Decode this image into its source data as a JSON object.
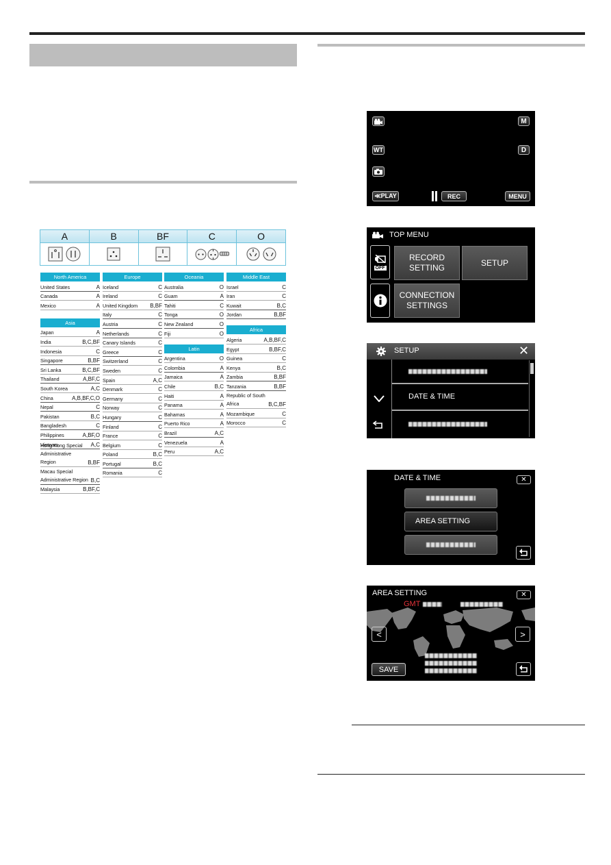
{
  "plug_types": [
    {
      "label": "A",
      "icons": [
        "plug-a-flat-ground-icon",
        "plug-a-flat-icon"
      ]
    },
    {
      "label": "B",
      "icons": [
        "plug-b-three-round-icon"
      ]
    },
    {
      "label": "BF",
      "icons": [
        "plug-bf-rectangular-icon"
      ]
    },
    {
      "label": "C",
      "icons": [
        "plug-c-two-round-icon",
        "plug-c-grounded-icon",
        "plug-c-side-icon"
      ]
    },
    {
      "label": "O",
      "icons": [
        "plug-o-three-angled-icon",
        "plug-o-two-angled-icon"
      ]
    }
  ],
  "regions": {
    "north_america": {
      "title": "North America",
      "rows": [
        {
          "country": "United States",
          "types": "A"
        },
        {
          "country": "Canada",
          "types": "A"
        },
        {
          "country": "Mexico",
          "types": "A"
        }
      ]
    },
    "asia": {
      "title": "Asia",
      "rows": [
        {
          "country": "Japan",
          "types": "A"
        },
        {
          "country": "India",
          "types": "B,C,BF"
        },
        {
          "country": "Indonesia",
          "types": "C"
        },
        {
          "country": "Singapore",
          "types": "B,BF"
        },
        {
          "country": "Sri Lanka",
          "types": "B,C,BF"
        },
        {
          "country": "Thailand",
          "types": "A,BF,C"
        },
        {
          "country": "South Korea",
          "types": "A,C"
        },
        {
          "country": "China",
          "types": "A,B,BF,C,O"
        },
        {
          "country": "Nepal",
          "types": "C"
        },
        {
          "country": "Pakistan",
          "types": "B,C"
        },
        {
          "country": "Bangladesh",
          "types": "C"
        },
        {
          "country": "Philippines",
          "types": "A,BF,O"
        },
        {
          "country": "Vietnam",
          "types": "A,C"
        },
        {
          "country": "Hong Kong Special Administrative Region",
          "line1": "Hong Kong Special",
          "line2": "Administrative Region",
          "types": "B,BF"
        },
        {
          "country": "Macau Special Administrative Region",
          "line1": "Macau Special",
          "line2": "Administrative Region",
          "types": "B,C"
        },
        {
          "country": "Malaysia",
          "types": "B,BF,C"
        }
      ]
    },
    "europe": {
      "title": "Europe",
      "rows": [
        {
          "country": "Iceland",
          "types": "C"
        },
        {
          "country": "Ireland",
          "types": "C"
        },
        {
          "country": "United Kingdom",
          "types": "B,BF"
        },
        {
          "country": "Italy",
          "types": "C"
        },
        {
          "country": "Austria",
          "types": "C"
        },
        {
          "country": "Netherlands",
          "types": "C"
        },
        {
          "country": "Canary Islands",
          "types": "C"
        },
        {
          "country": "Greece",
          "types": "C"
        },
        {
          "country": "Switzerland",
          "types": "C"
        },
        {
          "country": "Sweden",
          "types": "C"
        },
        {
          "country": "Spain",
          "types": "A,C"
        },
        {
          "country": "Denmark",
          "types": "C"
        },
        {
          "country": "Germany",
          "types": "C"
        },
        {
          "country": "Norway",
          "types": "C"
        },
        {
          "country": "Hungary",
          "types": "C"
        },
        {
          "country": "Finland",
          "types": "C"
        },
        {
          "country": "France",
          "types": "C"
        },
        {
          "country": "Belgium",
          "types": "C"
        },
        {
          "country": "Poland",
          "types": "B,C"
        },
        {
          "country": "Portugal",
          "types": "B,C"
        },
        {
          "country": "Romania",
          "types": "C"
        }
      ]
    },
    "oceania": {
      "title": "Oceania",
      "rows": [
        {
          "country": "Australia",
          "types": "O"
        },
        {
          "country": "Guam",
          "types": "A"
        },
        {
          "country": "Tahiti",
          "types": "C"
        },
        {
          "country": "Tonga",
          "types": "O"
        },
        {
          "country": "New Zealand",
          "types": "O"
        },
        {
          "country": "Fiji",
          "types": "O"
        }
      ]
    },
    "latin": {
      "title": "Latin",
      "rows": [
        {
          "country": "Argentina",
          "types": "O"
        },
        {
          "country": "Colombia",
          "types": "A"
        },
        {
          "country": "Jamaica",
          "types": "A"
        },
        {
          "country": "Chile",
          "types": "B,C"
        },
        {
          "country": "Haiti",
          "types": "A"
        },
        {
          "country": "Panama",
          "types": "A"
        },
        {
          "country": "Bahamas",
          "types": "A"
        },
        {
          "country": "Puerto Rico",
          "types": "A"
        },
        {
          "country": "Brazil",
          "types": "A,C"
        },
        {
          "country": "Venezuela",
          "types": "A"
        },
        {
          "country": "Peru",
          "types": "A,C"
        }
      ]
    },
    "middle_east": {
      "title": "Middle East",
      "rows": [
        {
          "country": "Israel",
          "types": "C"
        },
        {
          "country": "Iran",
          "types": "C"
        },
        {
          "country": "Kuwait",
          "types": "B,C"
        },
        {
          "country": "Jordan",
          "types": "B,BF"
        }
      ]
    },
    "africa": {
      "title": "Africa",
      "rows": [
        {
          "country": "Algeria",
          "types": "A,B,BF,C"
        },
        {
          "country": "Egypt",
          "types": "B,BF,C"
        },
        {
          "country": "Guinea",
          "types": "C"
        },
        {
          "country": "Kenya",
          "types": "B,C"
        },
        {
          "country": "Zambia",
          "types": "B,BF"
        },
        {
          "country": "Tanzania",
          "types": "B,BF"
        },
        {
          "country": "Republic of South Africa",
          "line1": "Republic of South",
          "line2": "Africa",
          "types": "B,C,BF"
        },
        {
          "country": "Mozambique",
          "types": "C"
        },
        {
          "country": "Morocco",
          "types": "C"
        }
      ]
    }
  },
  "screens": {
    "record": {
      "buttons": {
        "mode": "M",
        "wt": "WT",
        "d": "D",
        "play": "≪PLAY",
        "rec": "REC",
        "menu": "MENU"
      },
      "icons": [
        "video-mode-icon",
        "camera-icon",
        "pause-icon"
      ]
    },
    "top_menu": {
      "title": "TOP MENU",
      "tiles": {
        "record_setting": "RECORD SETTING",
        "setup": "SETUP",
        "connection_settings": "CONNECTION SETTINGS"
      },
      "off_label": "OFF"
    },
    "setup": {
      "title": "SETUP",
      "items": [
        "",
        "DATE & TIME",
        ""
      ]
    },
    "date_time": {
      "title": "DATE & TIME",
      "items": [
        "",
        "AREA SETTING",
        ""
      ]
    },
    "area_setting": {
      "title": "AREA SETTING",
      "gmt_label": "GMT",
      "save_label": "SAVE"
    }
  },
  "colors": {
    "region_header": "#1aaed0",
    "gmt_red": "#e8333a"
  }
}
